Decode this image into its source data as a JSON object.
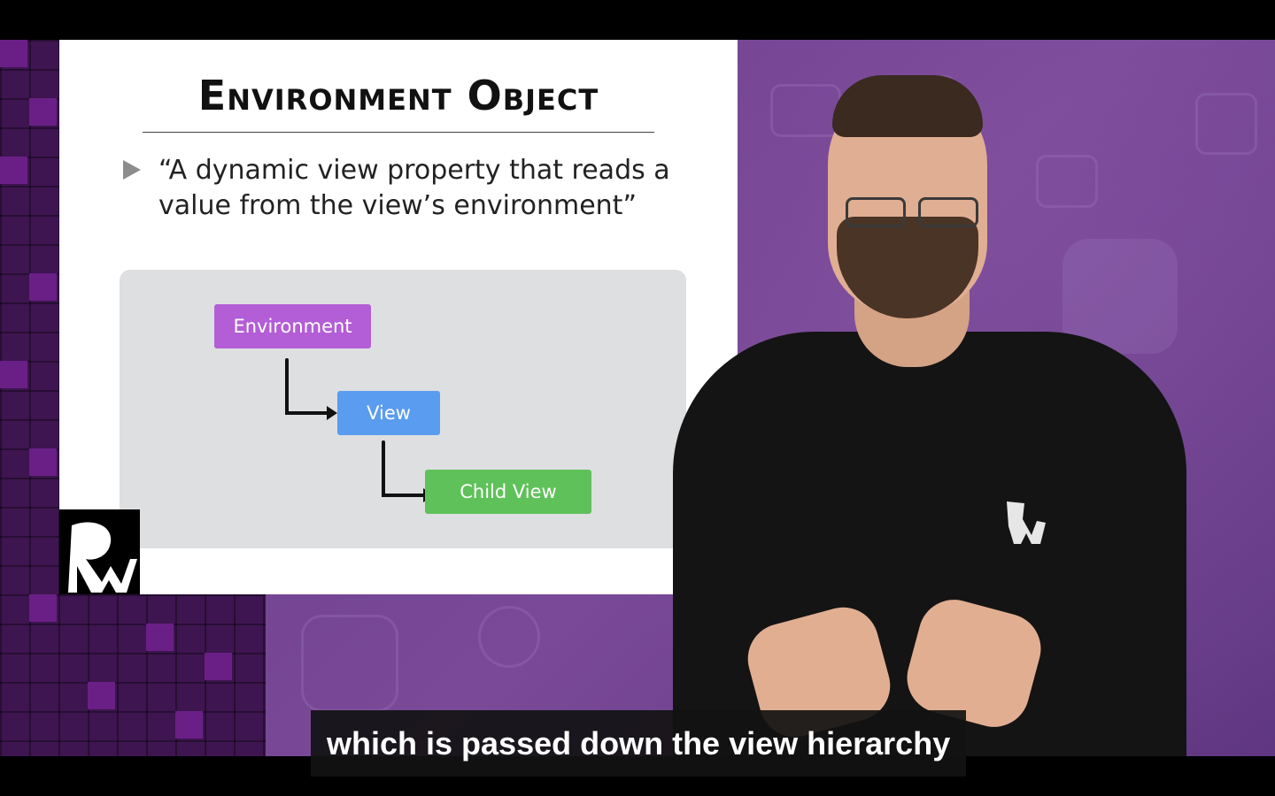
{
  "slide": {
    "title": "Environment Object",
    "bullet": "“A dynamic view property that reads a value from the view’s environment”",
    "diagram": {
      "nodes": [
        {
          "label": "Environment",
          "color": "#b35ed6"
        },
        {
          "label": "View",
          "color": "#5a9cef"
        },
        {
          "label": "Child View",
          "color": "#5fc15a"
        }
      ]
    }
  },
  "caption": {
    "text": "which is passed down the view hierarchy"
  },
  "icons": {
    "bullet": "triangle-bullet-icon",
    "logo": "rw-logo-icon",
    "arrow": "elbow-arrow-icon"
  },
  "colors": {
    "background_purple": "#6b3d8a",
    "tile_purple": "#6a1f86",
    "diagram_bg": "#dedfe1"
  }
}
